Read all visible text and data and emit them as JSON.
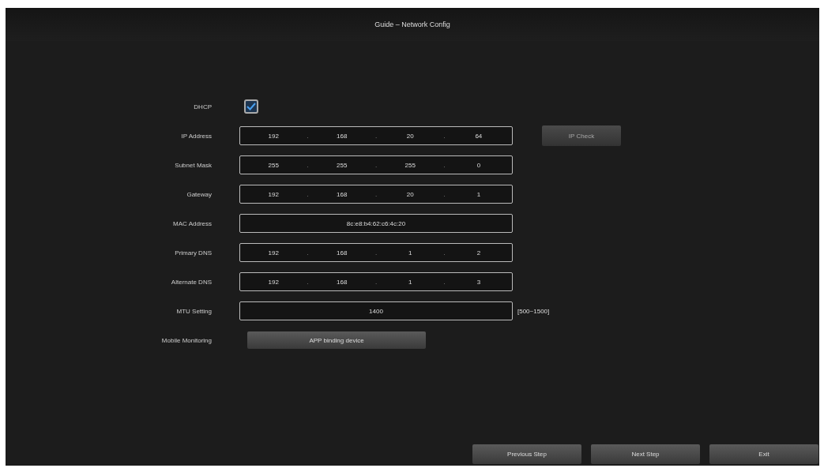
{
  "window": {
    "title": "Guide – Network Config"
  },
  "dhcp": {
    "label": "DHCP",
    "checked": true
  },
  "ip_check": {
    "label": "IP Check",
    "disabled": true
  },
  "fields": [
    {
      "label": "IP Address",
      "kind": "ip",
      "octets": [
        "192",
        "168",
        "20",
        "64"
      ]
    },
    {
      "label": "Subnet Mask",
      "kind": "ip",
      "octets": [
        "255",
        "255",
        "255",
        "0"
      ]
    },
    {
      "label": "Gateway",
      "kind": "ip",
      "octets": [
        "192",
        "168",
        "20",
        "1"
      ]
    },
    {
      "label": "MAC Address",
      "kind": "text",
      "value": "8c:e8:b4:62:c6:4c:20"
    },
    {
      "label": "Primary DNS",
      "kind": "ip",
      "octets": [
        "192",
        "168",
        "1",
        "2"
      ]
    },
    {
      "label": "Alternate DNS",
      "kind": "ip",
      "octets": [
        "192",
        "168",
        "1",
        "3"
      ]
    },
    {
      "label": "MTU Setting",
      "kind": "text",
      "value": "1400",
      "hint": "[500~1500]"
    }
  ],
  "separator": ".",
  "mobile": {
    "label": "Mobile Monitoring",
    "button": "APP binding device"
  },
  "buttons": [
    "Previous Step",
    "Next Step",
    "Exit"
  ]
}
